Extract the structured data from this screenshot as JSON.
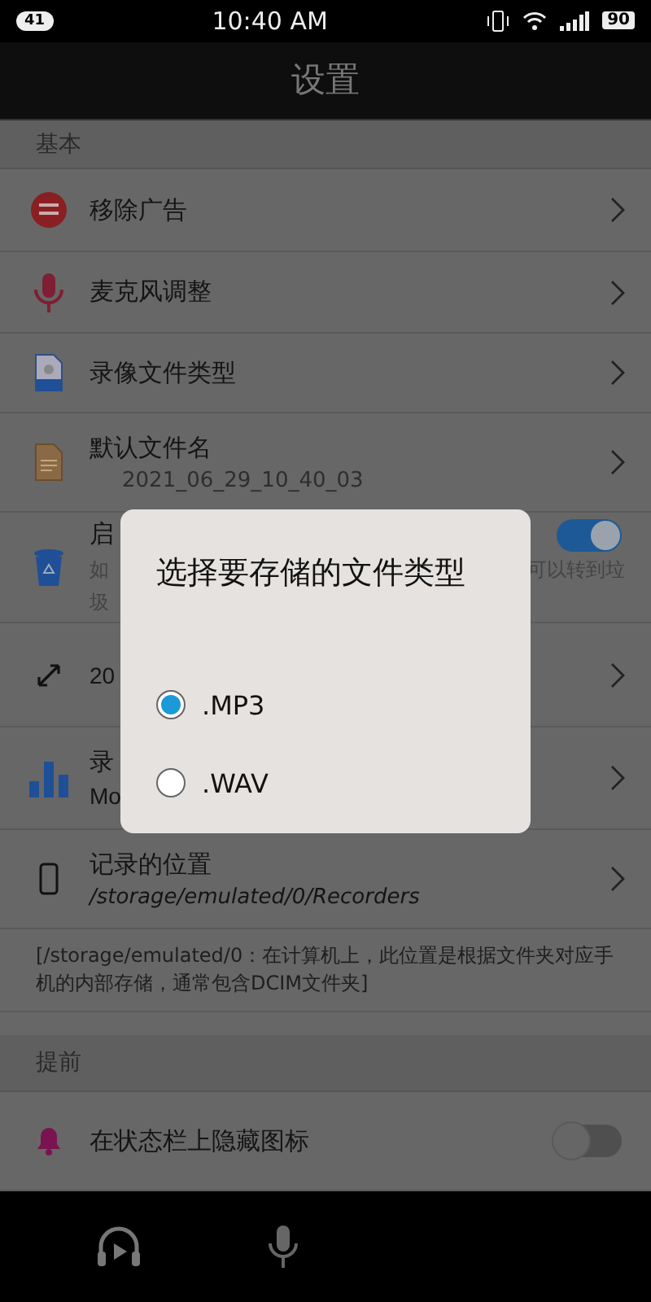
{
  "status_bar": {
    "notification_count": "41",
    "time": "10:40 AM",
    "battery": "90"
  },
  "title": "设置",
  "sections": [
    {
      "header": "基本",
      "items": [
        {
          "kind": "link",
          "title": "移除广告"
        },
        {
          "kind": "link",
          "title": "麦克风调整"
        },
        {
          "kind": "link",
          "title": "录像文件类型"
        },
        {
          "kind": "link",
          "title": "默认文件名",
          "subtitle": "2021_06_29_10_40_03"
        },
        {
          "kind": "toggle",
          "title": "启",
          "on": true,
          "description_left": "如",
          "description_right": "可以转到垃",
          "description_line_2": "圾"
        },
        {
          "kind": "link",
          "subtitle": "20"
        },
        {
          "kind": "link",
          "title": "录",
          "subtitle": "Mo"
        },
        {
          "kind": "path",
          "title": "记录的位置",
          "subtitle": "/storage/emulated/0/Recorders"
        }
      ],
      "note": "[/storage/emulated/0：在计算机上，此位置是根据文件夹对应手机的内部存储，通常包含DCIM文件夹]"
    },
    {
      "header": "提前",
      "items": [
        {
          "kind": "toggle",
          "title": "在状态栏上隐藏图标",
          "on": false
        }
      ]
    }
  ],
  "dialog": {
    "title": "选择要存储的文件类型",
    "options": [
      {
        "label": ".MP3",
        "selected": true
      },
      {
        "label": ".WAV",
        "selected": false
      }
    ]
  }
}
